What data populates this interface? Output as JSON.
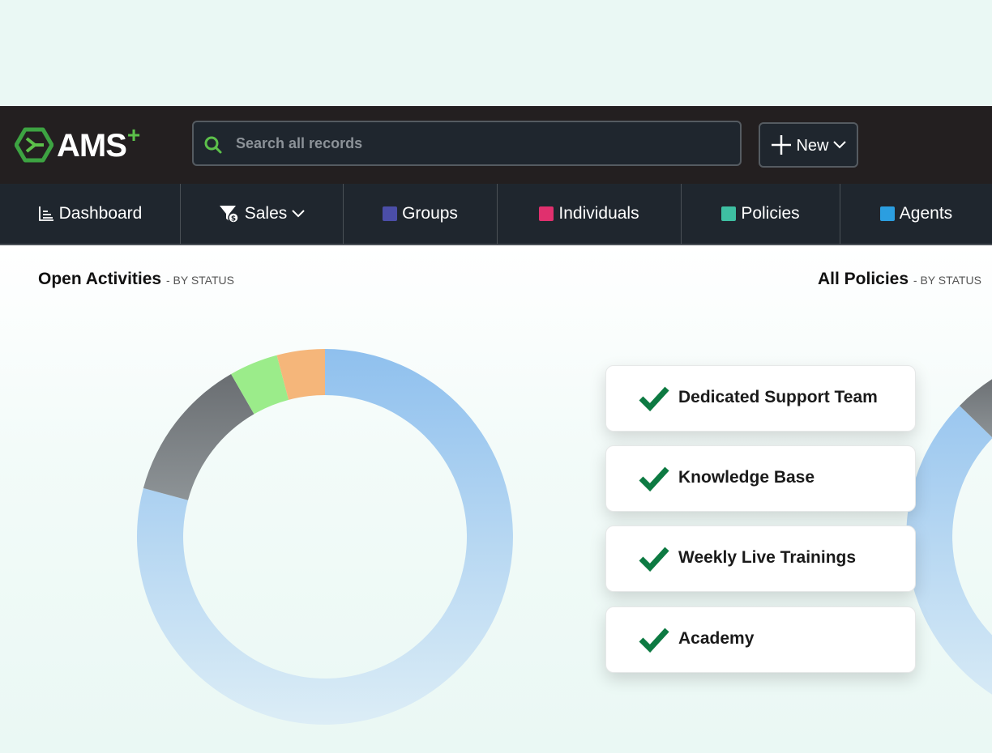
{
  "app": {
    "logo_text": "AMS",
    "logo_superscript": "+"
  },
  "search": {
    "placeholder": "Search all records",
    "value": ""
  },
  "new_button": {
    "label": "New"
  },
  "nav": [
    {
      "label": "Dashboard",
      "icon": "dashboard-chart-icon"
    },
    {
      "label": "Sales",
      "icon": "funnel-dollar-icon",
      "has_dropdown": true
    },
    {
      "label": "Groups",
      "color": "#4b4ea8"
    },
    {
      "label": "Individuals",
      "color": "#e0306e"
    },
    {
      "label": "Policies",
      "color": "#3ebfa2"
    },
    {
      "label": "Agents",
      "color": "#2b9ee0"
    }
  ],
  "left_panel": {
    "title": "Open Activities",
    "subtitle": "- BY STATUS"
  },
  "right_panel": {
    "title": "All Policies",
    "subtitle": "- BY STATUS"
  },
  "features": [
    "Dedicated Support Team",
    "Knowledge Base",
    "Weekly Live Trainings",
    "Academy"
  ],
  "colors": {
    "topbar": "#231f20",
    "navbar": "#1f262e",
    "accent_green": "#5cc04a",
    "check_green": "#0d7a42"
  }
}
